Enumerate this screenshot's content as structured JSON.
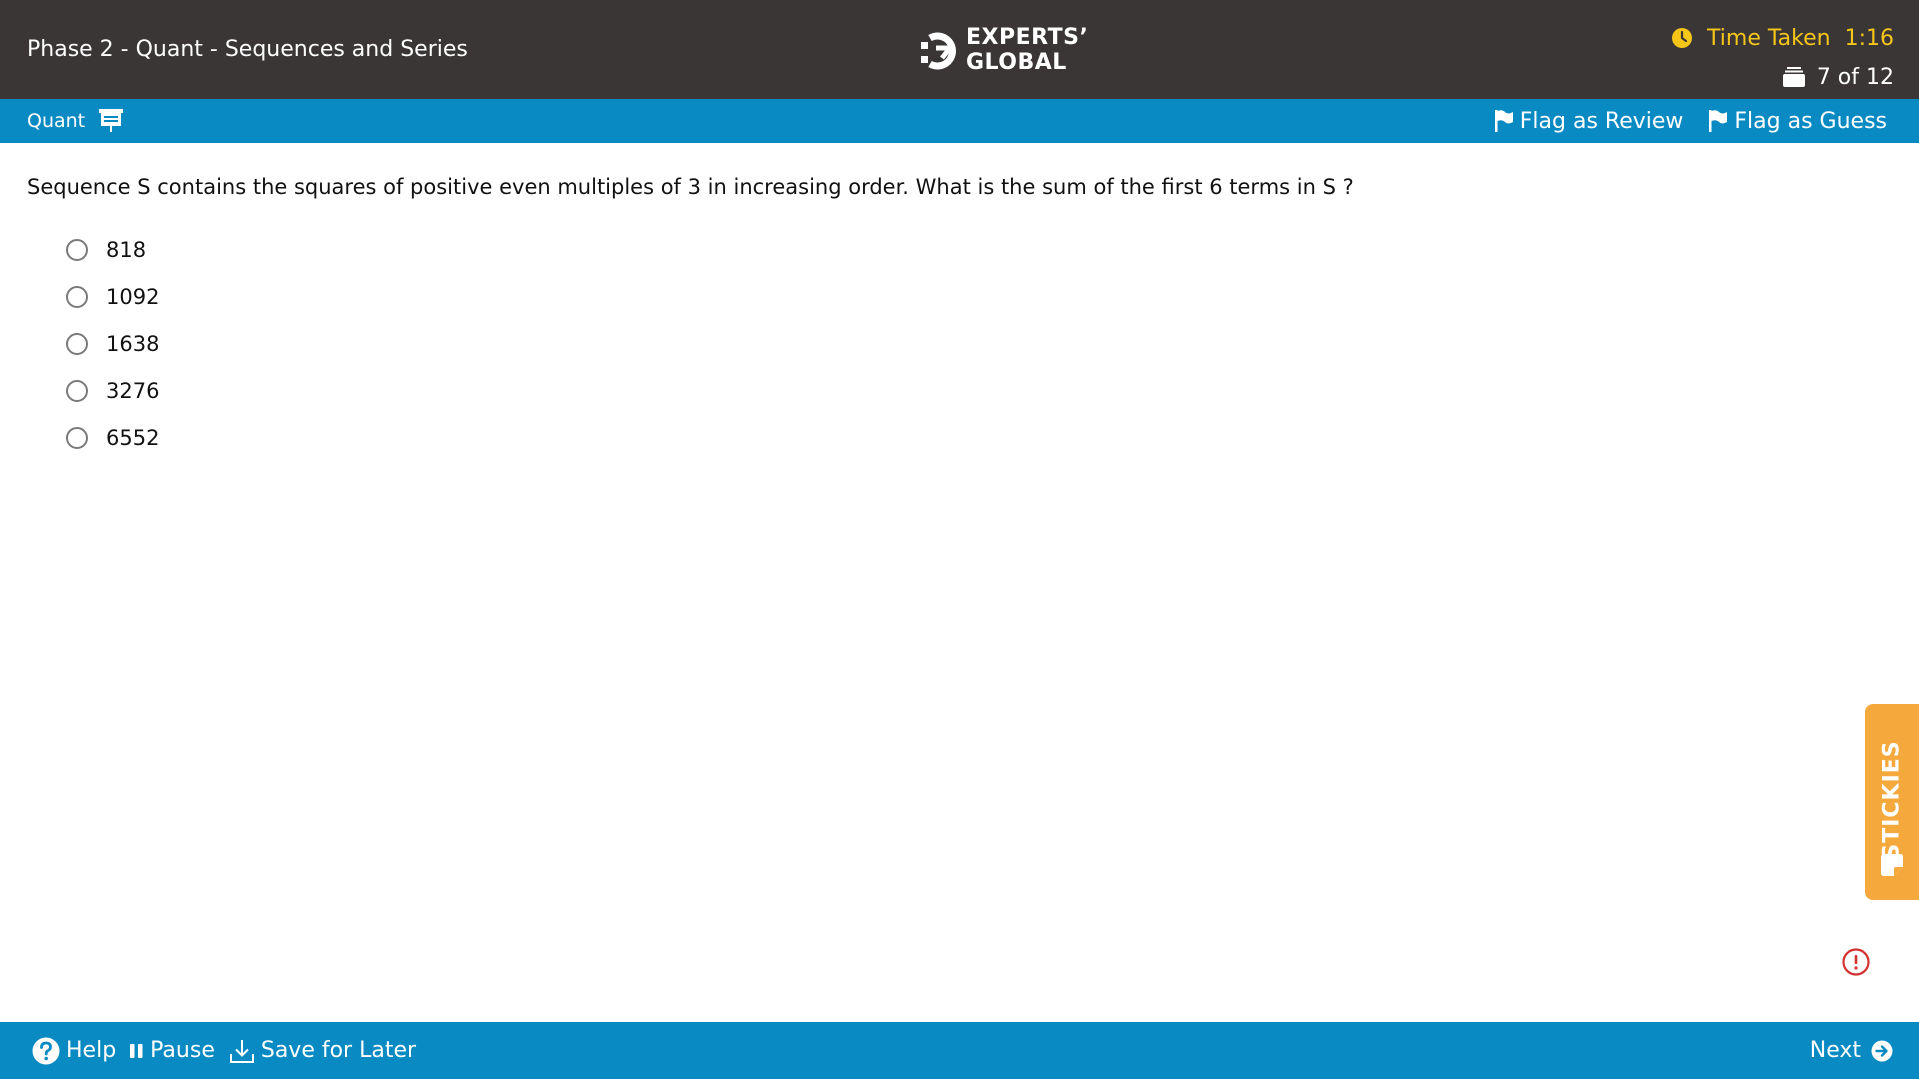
{
  "header": {
    "title": "Phase 2 - Quant - Sequences and Series",
    "logo_line1": "EXPERTS’",
    "logo_line2": "GLOBAL",
    "timer_label": "Time Taken",
    "timer_value": "1:16",
    "question_counter": "7 of 12"
  },
  "section_bar": {
    "section_name": "Quant",
    "flag_review_label": "Flag as Review",
    "flag_guess_label": "Flag as Guess"
  },
  "question": {
    "text": "Sequence S contains the squares of positive even multiples of 3 in increasing order. What is the sum of the first 6 terms in S ?",
    "options": [
      "818",
      "1092",
      "1638",
      "3276",
      "6552"
    ]
  },
  "stickies": {
    "label": "STICKIES"
  },
  "footer": {
    "help_label": "Help",
    "pause_label": "Pause",
    "save_label": "Save for Later",
    "next_label": "Next"
  },
  "colors": {
    "header_bg": "#3a3636",
    "accent_blue": "#0a8ac2",
    "timer_yellow": "#f5c518",
    "stickies_orange": "#f5a93c",
    "alert_red": "#d32f2f"
  },
  "icons": {
    "logo": "experts-global-logo-icon",
    "timer": "clock-icon",
    "counter": "stack-icon",
    "section": "calculator-icon",
    "flag": "flag-icon",
    "help": "help-circle-icon",
    "pause": "pause-icon",
    "save": "download-icon",
    "next": "arrow-right-circle-icon",
    "alert": "alert-circle-icon",
    "note": "sticky-note-icon"
  }
}
